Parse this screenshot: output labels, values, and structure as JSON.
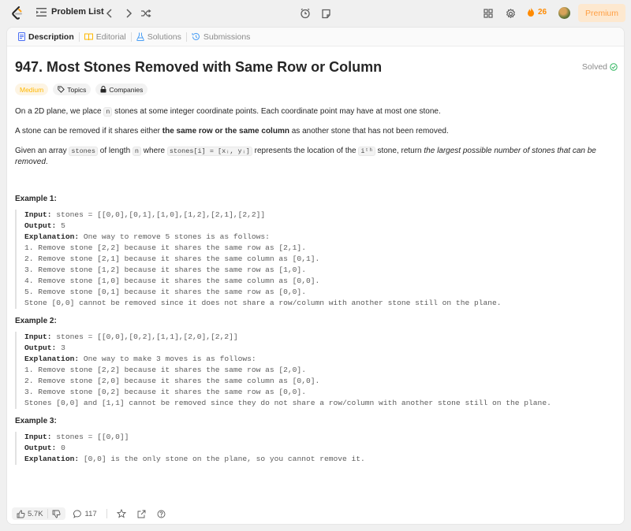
{
  "nav": {
    "problem_list_label": "Problem List",
    "streak_count": "26",
    "premium_label": "Premium"
  },
  "tabs": [
    {
      "label": "Description",
      "icon": "description-icon",
      "color": "#4a6ef5"
    },
    {
      "label": "Editorial",
      "icon": "editorial-icon",
      "color": "#ffb800"
    },
    {
      "label": "Solutions",
      "icon": "solutions-icon",
      "color": "#4a9ef5"
    },
    {
      "label": "Submissions",
      "icon": "submissions-icon",
      "color": "#4a9ef5"
    }
  ],
  "problem": {
    "title": "947. Most Stones Removed with Same Row or Column",
    "status": "Solved",
    "difficulty": "Medium",
    "tag_topics": "Topics",
    "tag_companies": "Companies",
    "p1_a": "On a 2D plane, we place ",
    "p1_code": "n",
    "p1_b": " stones at some integer coordinate points. Each coordinate point may have at most one stone.",
    "p2_a": "A stone can be removed if it shares either ",
    "p2_bold": "the same row or the same column",
    "p2_b": " as another stone that has not been removed.",
    "p3_a": "Given an array ",
    "p3_code1": "stones",
    "p3_b": " of length ",
    "p3_code2": "n",
    "p3_c": " where ",
    "p3_code3": "stones[i] = [xᵢ, yᵢ]",
    "p3_d": " represents the location of the ",
    "p3_code4": "iᵗʰ",
    "p3_e": " stone, return ",
    "p3_italic": "the largest possible number of stones that can be removed",
    "p3_f": "."
  },
  "examples": [
    {
      "title": "Example 1:",
      "input_label": "Input:",
      "input": " stones = [[0,0],[0,1],[1,0],[1,2],[2,1],[2,2]]",
      "output_label": "Output:",
      "output": " 5",
      "explanation_label": "Explanation:",
      "explanation": " One way to remove 5 stones is as follows:\n1. Remove stone [2,2] because it shares the same row as [2,1].\n2. Remove stone [2,1] because it shares the same column as [0,1].\n3. Remove stone [1,2] because it shares the same row as [1,0].\n4. Remove stone [1,0] because it shares the same column as [0,0].\n5. Remove stone [0,1] because it shares the same row as [0,0].\nStone [0,0] cannot be removed since it does not share a row/column with another stone still on the plane."
    },
    {
      "title": "Example 2:",
      "input_label": "Input:",
      "input": " stones = [[0,0],[0,2],[1,1],[2,0],[2,2]]",
      "output_label": "Output:",
      "output": " 3",
      "explanation_label": "Explanation:",
      "explanation": " One way to make 3 moves is as follows:\n1. Remove stone [2,2] because it shares the same row as [2,0].\n2. Remove stone [2,0] because it shares the same column as [0,0].\n3. Remove stone [0,2] because it shares the same row as [0,0].\nStones [0,0] and [1,1] cannot be removed since they do not share a row/column with another stone still on the plane."
    },
    {
      "title": "Example 3:",
      "input_label": "Input:",
      "input": " stones = [[0,0]]",
      "output_label": "Output:",
      "output": " 0",
      "explanation_label": "Explanation:",
      "explanation": " [0,0] is the only stone on the plane, so you cannot remove it."
    }
  ],
  "actions": {
    "likes": "5.7K",
    "comments": "117"
  },
  "colors": {
    "accent_orange": "#ff8a00",
    "solved_green": "#2db55d",
    "difficulty_medium": "#ffb800"
  }
}
